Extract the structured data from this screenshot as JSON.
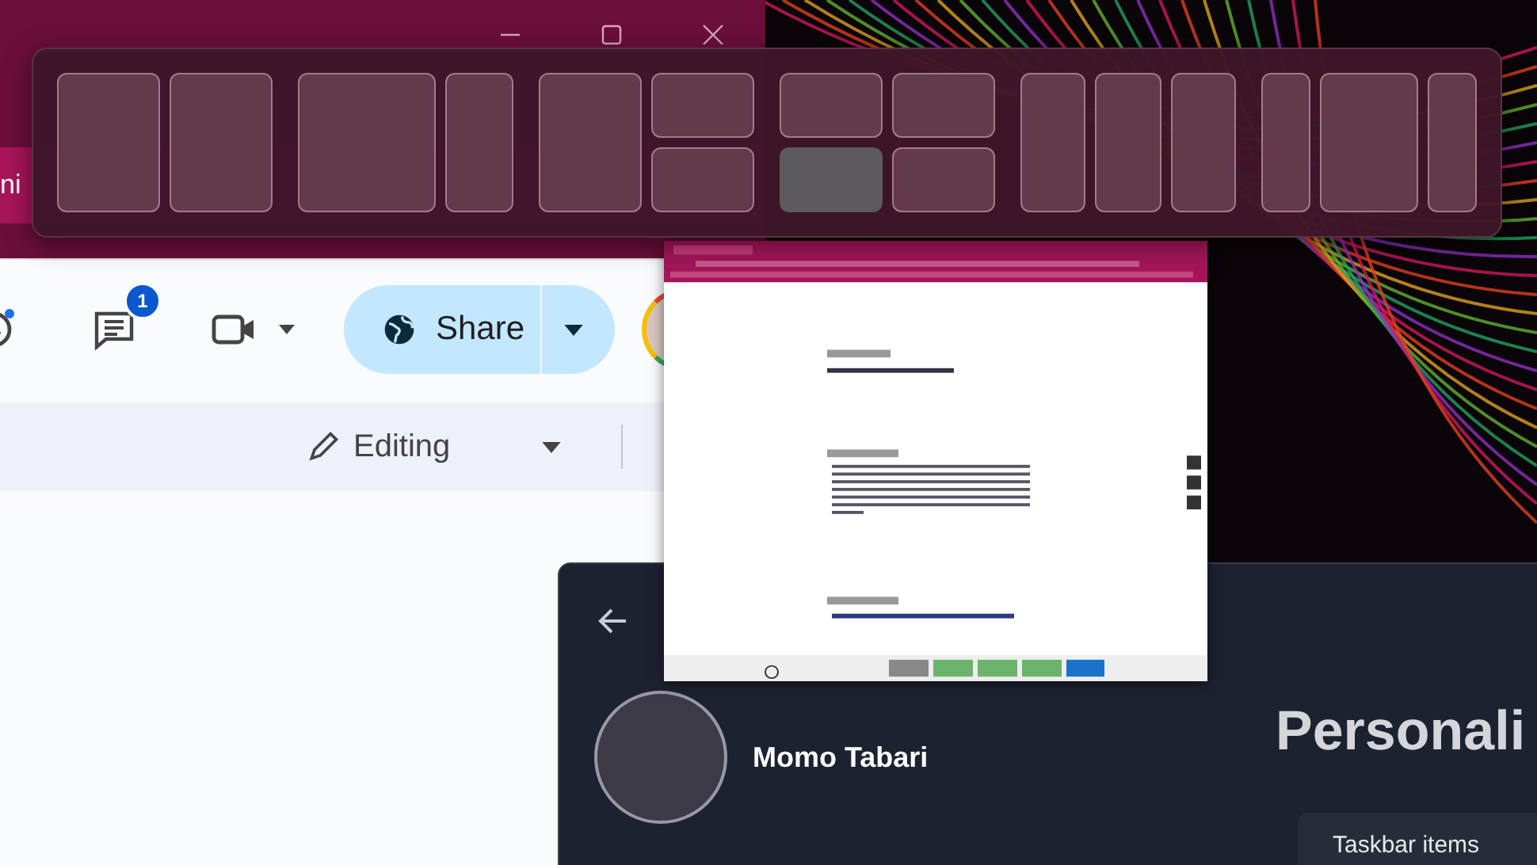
{
  "browser_window": {
    "tab_title": "ni"
  },
  "docs_toolbar": {
    "comments_badge": "1",
    "share_label": "Share",
    "mode_label": "Editing"
  },
  "snap_layouts": [
    {
      "kind": "halves",
      "zones": [
        {
          "selected": false
        },
        {
          "selected": false
        }
      ]
    },
    {
      "kind": "two-thirds",
      "zones": [
        {
          "selected": false
        },
        {
          "selected": false
        }
      ]
    },
    {
      "kind": "main-stack",
      "zones": [
        {
          "selected": false
        },
        {
          "selected": false
        },
        {
          "selected": false
        }
      ]
    },
    {
      "kind": "quad",
      "zones": [
        {
          "selected": false
        },
        {
          "selected": false
        },
        {
          "selected": true
        },
        {
          "selected": false
        }
      ]
    },
    {
      "kind": "thirds",
      "zones": [
        {
          "selected": false
        },
        {
          "selected": false
        },
        {
          "selected": false
        }
      ]
    },
    {
      "kind": "wide-center",
      "zones": [
        {
          "selected": false
        },
        {
          "selected": false
        },
        {
          "selected": false
        }
      ]
    }
  ],
  "settings_window": {
    "user_name": "Momo Tabari",
    "page_title": "Personali",
    "card_title": "Taskbar items"
  }
}
